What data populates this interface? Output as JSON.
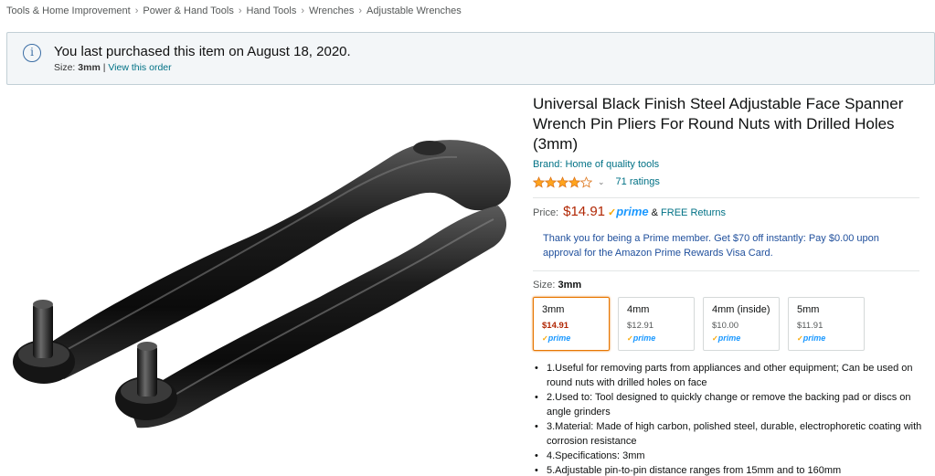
{
  "breadcrumb": [
    "Tools & Home Improvement",
    "Power & Hand Tools",
    "Hand Tools",
    "Wrenches",
    "Adjustable Wrenches"
  ],
  "notice": {
    "message": "You last purchased this item on August 18, 2020.",
    "size_label": "Size:",
    "size_value": "3mm",
    "separator": "|",
    "view_order": "View this order",
    "icon": "info-icon"
  },
  "product": {
    "title": "Universal Black Finish Steel Adjustable Face Spanner Wrench Pin Pliers For Round Nuts with Drilled Holes (3mm)",
    "brand": "Brand: Home of quality tools",
    "rating_stars": 4,
    "rating_count": "71 ratings",
    "price_label": "Price:",
    "price": "$14.91",
    "prime_text": "prime",
    "returns_amp": "&",
    "free_returns": "FREE Returns",
    "prime_offer": "Thank you for being a Prime member. Get $70 off instantly: Pay $0.00 upon approval for the Amazon Prime Rewards Visa Card.",
    "size_label": "Size:",
    "size_selected": "3mm"
  },
  "swatches": [
    {
      "name": "3mm",
      "price": "$14.91",
      "prime": "prime",
      "selected": true
    },
    {
      "name": "4mm",
      "price": "$12.91",
      "prime": "prime",
      "selected": false
    },
    {
      "name": "4mm (inside)",
      "price": "$10.00",
      "prime": "prime",
      "selected": false
    },
    {
      "name": "5mm",
      "price": "$11.91",
      "prime": "prime",
      "selected": false
    }
  ],
  "bullets": [
    "1.Useful for removing parts from appliances and other equipment; Can be used on round nuts with drilled holes on face",
    "2.Used to: Tool designed to quickly change or remove the backing pad or discs on angle grinders",
    "3.Material: Made of high carbon, polished steel, durable, electrophoretic coating with corrosion resistance",
    "4.Specifications: 3mm",
    "5.Adjustable pin-to-pin distance ranges from 15mm and to 160mm"
  ],
  "colors": {
    "link": "#007185",
    "price": "#b12704",
    "prime": "#1a98ff",
    "selected_border": "#e77600"
  }
}
